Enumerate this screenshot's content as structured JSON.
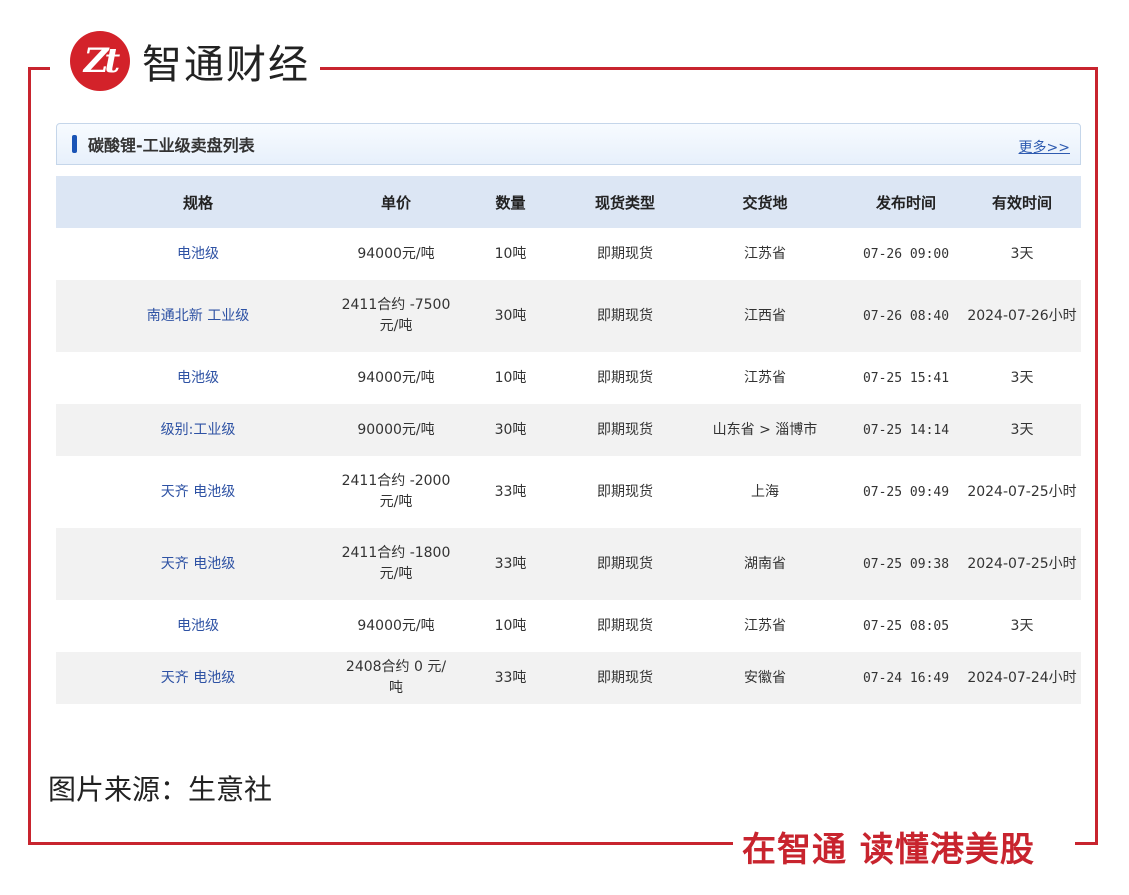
{
  "brand": {
    "logo_mark": "Zt",
    "name": "智通财经",
    "slogan": "在智通 读懂港美股",
    "accent_color": "#c8242e"
  },
  "panel": {
    "title": "碳酸锂-工业级卖盘列表",
    "more_link": "更多>>"
  },
  "table": {
    "columns": [
      "规格",
      "单价",
      "数量",
      "现货类型",
      "交货地",
      "发布时间",
      "有效时间"
    ],
    "rows": [
      {
        "spec": "电池级",
        "price": "94000元/吨",
        "qty": "10吨",
        "type": "即期现货",
        "location": "江苏省",
        "published": "07-26 09:00",
        "valid": "3天"
      },
      {
        "spec": "南通北新 工业级",
        "price": "2411合约 -7500元/吨",
        "qty": "30吨",
        "type": "即期现货",
        "location": "江西省",
        "published": "07-26 08:40",
        "valid": "2024-07-26小时"
      },
      {
        "spec": "电池级",
        "price": "94000元/吨",
        "qty": "10吨",
        "type": "即期现货",
        "location": "江苏省",
        "published": "07-25 15:41",
        "valid": "3天"
      },
      {
        "spec": "级别:工业级",
        "price": "90000元/吨",
        "qty": "30吨",
        "type": "即期现货",
        "location": "山东省 > 淄博市",
        "published": "07-25 14:14",
        "valid": "3天"
      },
      {
        "spec": "天齐 电池级",
        "price": "2411合约 -2000元/吨",
        "qty": "33吨",
        "type": "即期现货",
        "location": "上海",
        "published": "07-25 09:49",
        "valid": "2024-07-25小时"
      },
      {
        "spec": "天齐 电池级",
        "price": "2411合约 -1800元/吨",
        "qty": "33吨",
        "type": "即期现货",
        "location": "湖南省",
        "published": "07-25 09:38",
        "valid": "2024-07-25小时"
      },
      {
        "spec": "电池级",
        "price": "94000元/吨",
        "qty": "10吨",
        "type": "即期现货",
        "location": "江苏省",
        "published": "07-25 08:05",
        "valid": "3天"
      },
      {
        "spec": "天齐 电池级",
        "price": "2408合约 0 元/吨",
        "qty": "33吨",
        "type": "即期现货",
        "location": "安徽省",
        "published": "07-24 16:49",
        "valid": "2024-07-24小时"
      }
    ]
  },
  "caption": "图片来源：生意社"
}
